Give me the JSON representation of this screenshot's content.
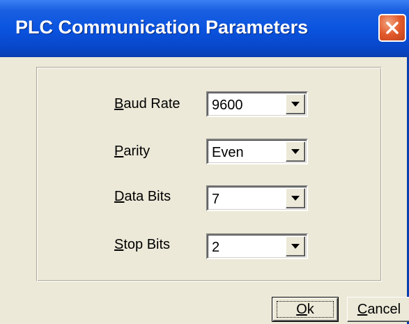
{
  "window": {
    "title": "PLC Communication Parameters"
  },
  "fields": [
    {
      "label_first": "B",
      "label_rest": "aud Rate",
      "value": "9600"
    },
    {
      "label_first": "P",
      "label_rest": "arity",
      "value": "Even"
    },
    {
      "label_first": "D",
      "label_rest": "ata Bits",
      "value": "7"
    },
    {
      "label_first": "S",
      "label_rest": "top Bits",
      "value": "2"
    }
  ],
  "buttons": {
    "ok_first": "O",
    "ok_rest": "k",
    "cancel_first": "C",
    "cancel_rest": "ancel"
  },
  "colors": {
    "titlebar": "#0a54e0",
    "close_button": "#e2592b",
    "dialog_background": "#ece9d8"
  },
  "icons": {
    "close": "close-icon",
    "dropdown": "chevron-down-icon"
  }
}
